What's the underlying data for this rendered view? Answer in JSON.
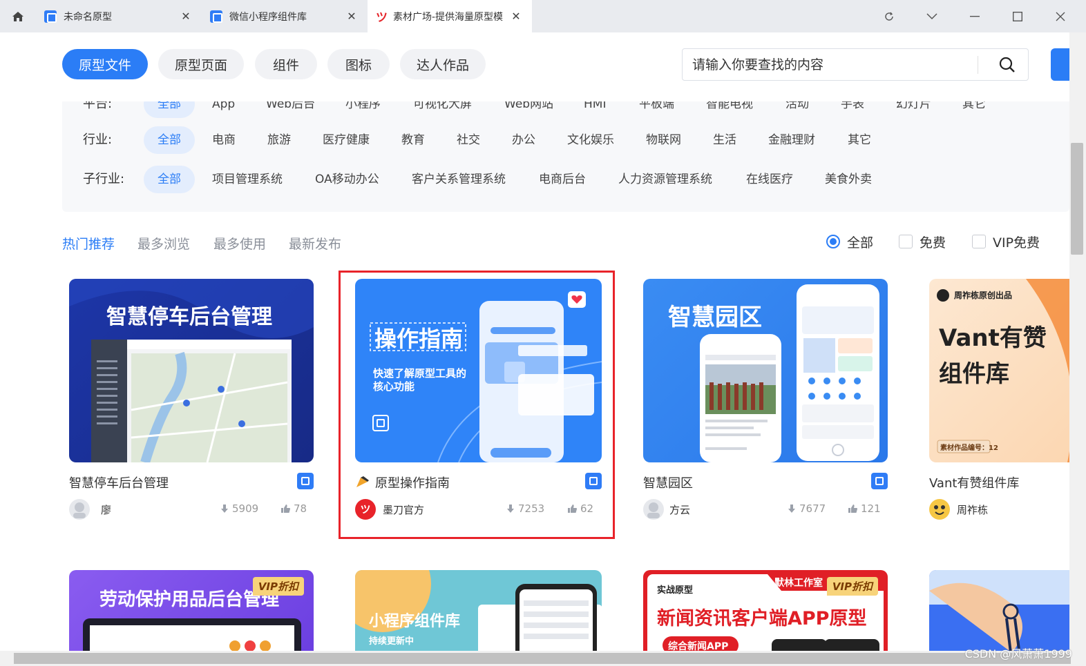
{
  "tabs": [
    {
      "label": "未命名原型"
    },
    {
      "label": "微信小程序组件库"
    },
    {
      "label": "素材广场-提供海量原型模"
    }
  ],
  "nav_pills": [
    "原型文件",
    "原型页面",
    "组件",
    "图标",
    "达人作品"
  ],
  "search": {
    "placeholder": "请输入你要查找的内容"
  },
  "filters": {
    "platform": {
      "label": "平台:",
      "options": [
        "全部",
        "App",
        "Web后台",
        "小程序",
        "可视化大屏",
        "Web网站",
        "HMI",
        "平板端",
        "智能电视",
        "活动",
        "手表",
        "幻灯片",
        "其它"
      ]
    },
    "industry": {
      "label": "行业:",
      "options": [
        "全部",
        "电商",
        "旅游",
        "医疗健康",
        "教育",
        "社交",
        "办公",
        "文化娱乐",
        "物联网",
        "生活",
        "金融理财",
        "其它"
      ]
    },
    "sub_industry": {
      "label": "子行业:",
      "options": [
        "全部",
        "项目管理系统",
        "OA移动办公",
        "客户关系管理系统",
        "电商后台",
        "人力资源管理系统",
        "在线医疗",
        "美食外卖"
      ]
    }
  },
  "sort_tabs": [
    "热门推荐",
    "最多浏览",
    "最多使用",
    "最新发布"
  ],
  "price_filters": [
    "全部",
    "免费",
    "VIP免费"
  ],
  "cards": [
    {
      "title": "智慧停车后台管理",
      "thumb_text": "智慧停车后台管理",
      "author": "廖",
      "downloads": "5909",
      "likes": "78"
    },
    {
      "title": "原型操作指南",
      "thumb_text": "操作指南",
      "thumb_sub": "快速了解原型工具的核心功能",
      "author": "墨刀官方",
      "downloads": "7253",
      "likes": "62"
    },
    {
      "title": "智慧园区",
      "thumb_text": "智慧园区",
      "author": "方云",
      "downloads": "7677",
      "likes": "121"
    },
    {
      "title": "Vant有赞组件库",
      "thumb_text": "Vant有赞组件库",
      "thumb_brand": "周祚栋原创出品",
      "thumb_code": "素材作品编号：12",
      "author": "周祚栋"
    }
  ],
  "cards_row2": [
    {
      "thumb_text": "劳动保护用品后台管理",
      "vip": "VIP折扣"
    },
    {
      "thumb_text": "小程序组件库",
      "thumb_sub": "持续更新中"
    },
    {
      "thumb_text": "新闻资讯客户端APP原型",
      "thumb_top": "实战原型",
      "thumb_brand": "默林工作室",
      "thumb_chip": "综合新闻APP",
      "vip": "VIP折扣"
    },
    {
      "thumb_text": ""
    }
  ],
  "watermark": "CSDN @风萧萧1999",
  "colors": {
    "accent": "#2b7df6",
    "highlight": "#e8232a"
  }
}
